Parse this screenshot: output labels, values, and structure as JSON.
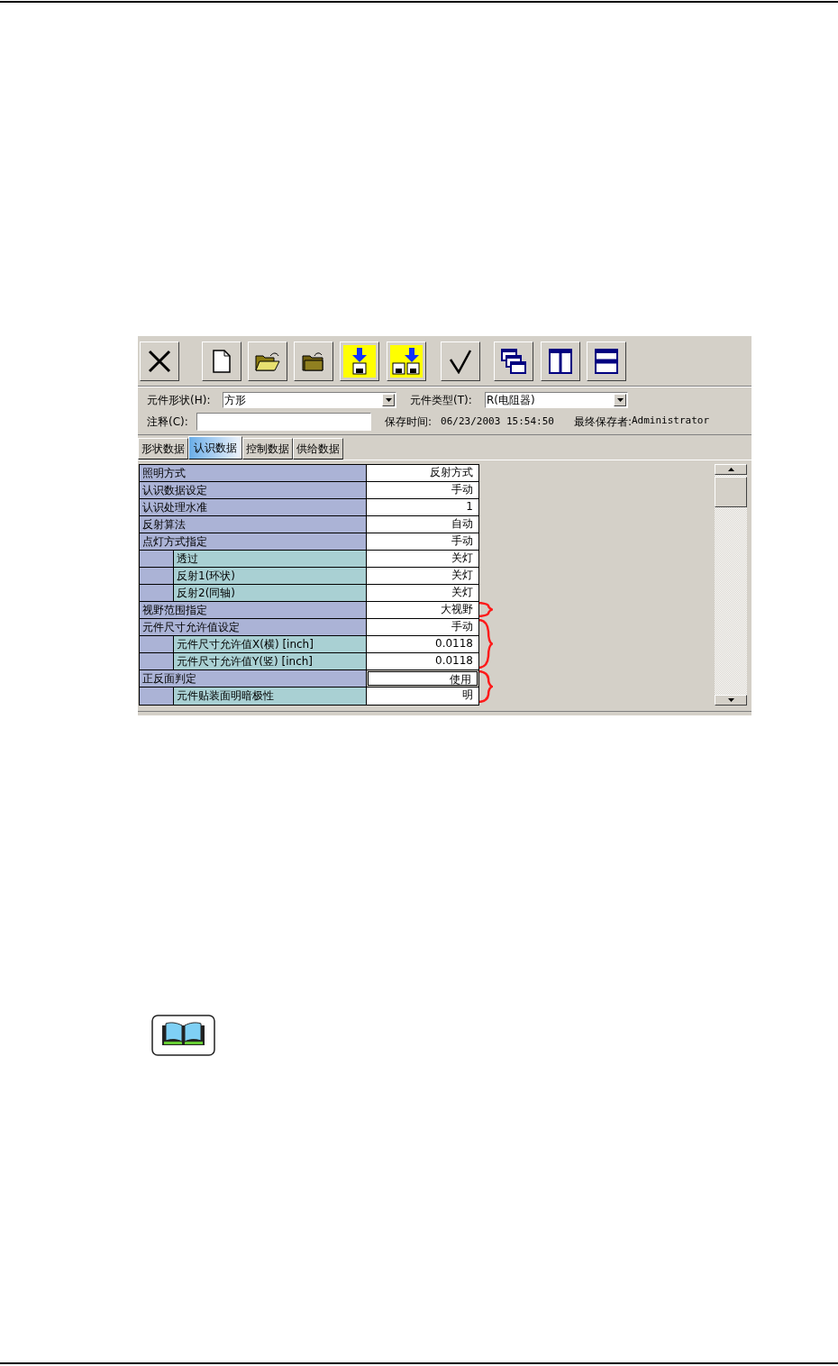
{
  "form": {
    "shape_label": "元件形状(H):",
    "shape_value": "方形",
    "type_label": "元件类型(T):",
    "type_value": "R(电阻器)",
    "comment_label": "注释(C):",
    "save_time_label": "保存时间:",
    "save_time": "06/23/2003 15:54:50",
    "saver_label": "最终保存者:",
    "saver": "Administrator"
  },
  "tabs": [
    {
      "label": "形状数据",
      "selected": false
    },
    {
      "label": "认识数据",
      "selected": true
    },
    {
      "label": "控制数据",
      "selected": false
    },
    {
      "label": "供给数据",
      "selected": false
    }
  ],
  "rows": [
    {
      "label": "照明方式",
      "value": "反射方式",
      "selected": false,
      "bracket": false
    },
    {
      "label": "认识数据设定",
      "value": "手动",
      "selected": false,
      "bracket": false
    },
    {
      "label": "认识处理水准",
      "value": "1",
      "selected": false,
      "bracket": false
    },
    {
      "label": "反射算法",
      "value": "自动",
      "selected": false,
      "bracket": false
    },
    {
      "label": "点灯方式指定",
      "value": "手动",
      "selected": false,
      "bracket": false,
      "children": [
        {
          "label": "透过",
          "value": "关灯",
          "selected": false
        },
        {
          "label": "反射1(环状)",
          "value": "关灯",
          "selected": false
        },
        {
          "label": "反射2(同轴)",
          "value": "关灯",
          "selected": false
        }
      ]
    },
    {
      "label": "视野范围指定",
      "value": "大视野",
      "selected": false,
      "bracket": true
    },
    {
      "label": "元件尺寸允许值设定",
      "value": "手动",
      "selected": false,
      "bracket": true,
      "children": [
        {
          "label": "元件尺寸允许值X(横) [inch]",
          "value": "0.0118",
          "selected": false
        },
        {
          "label": "元件尺寸允许值Y(竖) [inch]",
          "value": "0.0118",
          "selected": false
        }
      ]
    },
    {
      "label": "正反面判定",
      "value": "使用",
      "selected": true,
      "bracket": true,
      "children": [
        {
          "label": "元件贴装面明暗极性",
          "value": "明",
          "selected": false
        }
      ]
    }
  ]
}
